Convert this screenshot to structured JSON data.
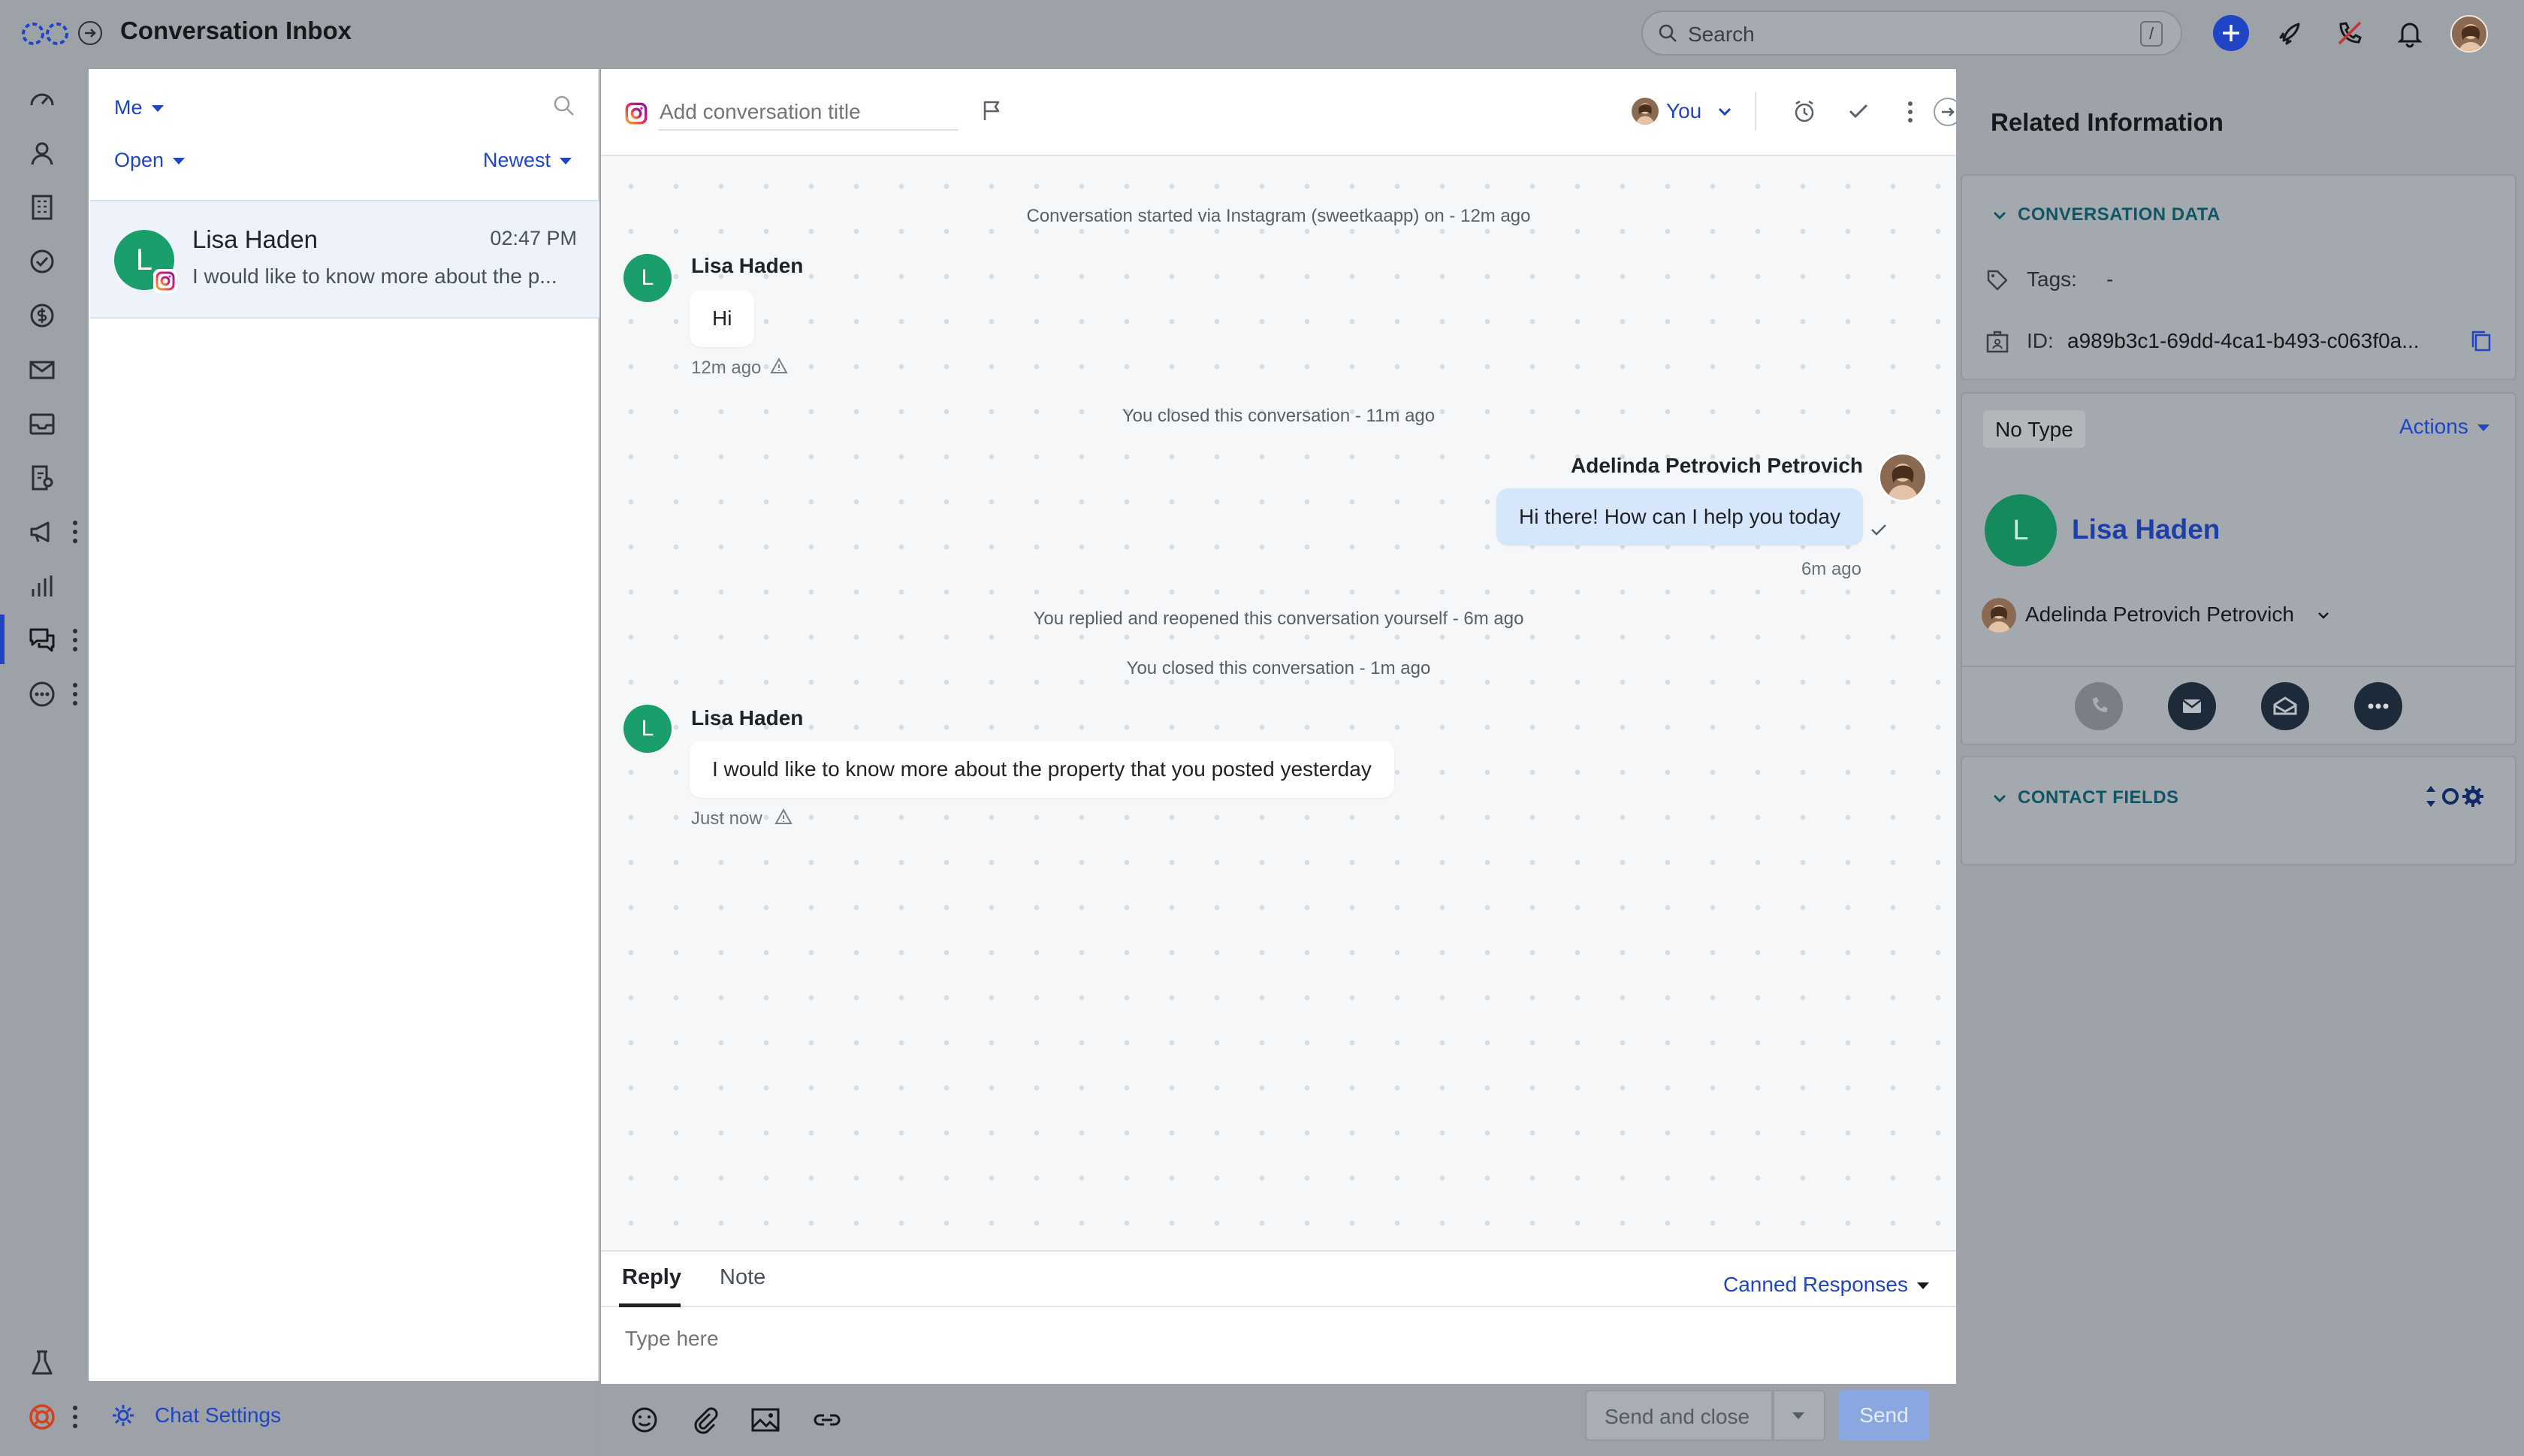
{
  "app": {
    "title": "Conversation Inbox"
  },
  "search": {
    "placeholder": "Search",
    "shortcut": "/"
  },
  "colors": {
    "accent": "#1f45c4",
    "avatar_green": "#1a9e6b",
    "outgoing_bubble": "#d7e7fb"
  },
  "list": {
    "assignee_filter": "Me",
    "status_filter": "Open",
    "sort": "Newest",
    "conversations": [
      {
        "initial": "L",
        "name": "Lisa Haden",
        "time": "02:47 PM",
        "preview": "I would like to know more about the p...",
        "channel": "instagram-icon"
      }
    ],
    "footer": {
      "settings_label": "Chat Settings"
    }
  },
  "chat": {
    "title_placeholder": "Add conversation title",
    "assignee": "You",
    "messages": [
      {
        "type": "system",
        "text": "Conversation started via Instagram (sweetkaapp) on - 12m ago"
      },
      {
        "type": "in",
        "initial": "L",
        "sender": "Lisa Haden",
        "text": "Hi",
        "time": "12m ago"
      },
      {
        "type": "system",
        "text": "You closed this conversation - 11m ago"
      },
      {
        "type": "out",
        "sender": "Adelinda Petrovich Petrovich",
        "text": "Hi there! How can I help you today",
        "time": "6m ago"
      },
      {
        "type": "system",
        "text": "You replied and reopened this conversation yourself - 6m ago"
      },
      {
        "type": "system",
        "text": "You closed this conversation - 1m ago"
      },
      {
        "type": "in",
        "initial": "L",
        "sender": "Lisa Haden",
        "text": "I would like to know more about the property that you posted yesterday",
        "time": "Just now"
      }
    ],
    "composer": {
      "tabs": [
        {
          "label": "Reply",
          "active": true
        },
        {
          "label": "Note",
          "active": false
        }
      ],
      "canned_label": "Canned Responses",
      "placeholder": "Type here",
      "send_close_label": "Send and close",
      "send_label": "Send"
    }
  },
  "right": {
    "title": "Related Information",
    "conversation_data": {
      "heading": "CONVERSATION DATA",
      "tags_label": "Tags:",
      "tags_value": "-",
      "id_label": "ID:",
      "id_value": "a989b3c1-69dd-4ca1-b493-c063f0a..."
    },
    "contact": {
      "type_badge": "No Type",
      "actions_label": "Actions",
      "initial": "L",
      "name": "Lisa Haden",
      "owner": "Adelinda Petrovich Petrovich"
    },
    "contact_fields": {
      "heading": "CONTACT FIELDS"
    }
  }
}
